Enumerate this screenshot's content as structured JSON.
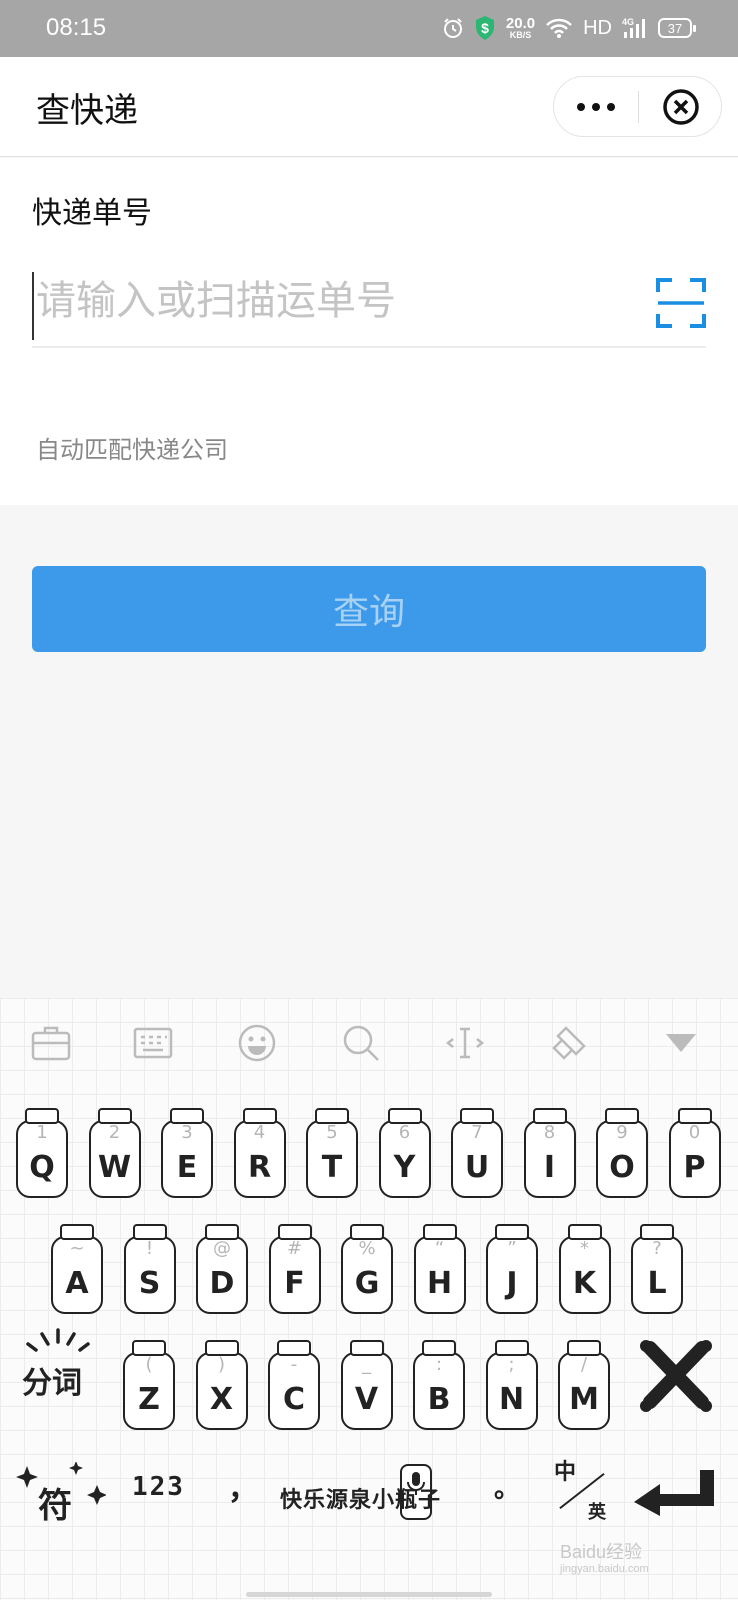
{
  "status_bar": {
    "time": "08:15",
    "net_speed_value": "20.0",
    "net_speed_unit": "KB/S",
    "hd": "HD",
    "network": "4G",
    "battery": "37"
  },
  "header": {
    "title": "查快递"
  },
  "form": {
    "label": "快递单号",
    "input_placeholder": "请输入或扫描运单号",
    "input_value": "",
    "hint": "自动匹配快递公司"
  },
  "query_button_label": "查询",
  "keyboard": {
    "row1": [
      {
        "ch": "Q",
        "sym": "1"
      },
      {
        "ch": "W",
        "sym": "2"
      },
      {
        "ch": "E",
        "sym": "3"
      },
      {
        "ch": "R",
        "sym": "4"
      },
      {
        "ch": "T",
        "sym": "5"
      },
      {
        "ch": "Y",
        "sym": "6"
      },
      {
        "ch": "U",
        "sym": "7"
      },
      {
        "ch": "I",
        "sym": "8"
      },
      {
        "ch": "O",
        "sym": "9"
      },
      {
        "ch": "P",
        "sym": "0"
      }
    ],
    "row2": [
      {
        "ch": "A",
        "sym": "~"
      },
      {
        "ch": "S",
        "sym": "!"
      },
      {
        "ch": "D",
        "sym": "@"
      },
      {
        "ch": "F",
        "sym": "#"
      },
      {
        "ch": "G",
        "sym": "%"
      },
      {
        "ch": "H",
        "sym": "“"
      },
      {
        "ch": "J",
        "sym": "”"
      },
      {
        "ch": "K",
        "sym": "*"
      },
      {
        "ch": "L",
        "sym": "?"
      }
    ],
    "row3": [
      {
        "ch": "Z",
        "sym": "("
      },
      {
        "ch": "X",
        "sym": ")"
      },
      {
        "ch": "C",
        "sym": "-"
      },
      {
        "ch": "V",
        "sym": "_"
      },
      {
        "ch": "B",
        "sym": ":"
      },
      {
        "ch": "N",
        "sym": ";"
      },
      {
        "ch": "M",
        "sym": "/"
      }
    ],
    "fenci_label": "分词",
    "symbols_label": "符",
    "numbers_label": "123",
    "comma": "，",
    "space_label": "快乐源泉小瓶子",
    "period": "。",
    "zh_label": "中",
    "en_label": "英"
  },
  "watermark": {
    "line1": "Baidu经验",
    "line2": "jingyan.baidu.com"
  }
}
